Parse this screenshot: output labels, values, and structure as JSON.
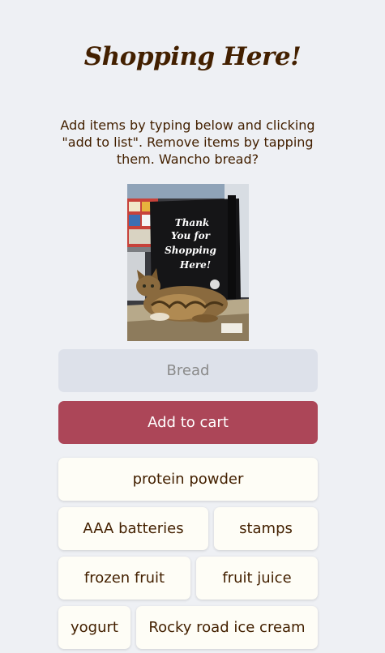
{
  "header": {
    "title": "Shopping Here!"
  },
  "intro": {
    "text": "Add items by typing below and clicking \"add to list\". Remove items by tapping them. Wancho bread?"
  },
  "photo": {
    "bag_text": [
      "Thank",
      "You for",
      "Shopping",
      "Here!"
    ]
  },
  "form": {
    "input_placeholder": "Bread",
    "input_value": "",
    "button_label": "Add to cart"
  },
  "shopping_list": {
    "items": [
      "protein powder",
      "AAA batteries",
      "stamps",
      "frozen fruit",
      "fruit juice",
      "yogurt",
      "Rocky road ice cream"
    ]
  },
  "colors": {
    "background": "#eef0f4",
    "text": "#432000",
    "button": "#ac4658",
    "input_background": "#dde1ea",
    "item_background": "#fefdf6"
  }
}
